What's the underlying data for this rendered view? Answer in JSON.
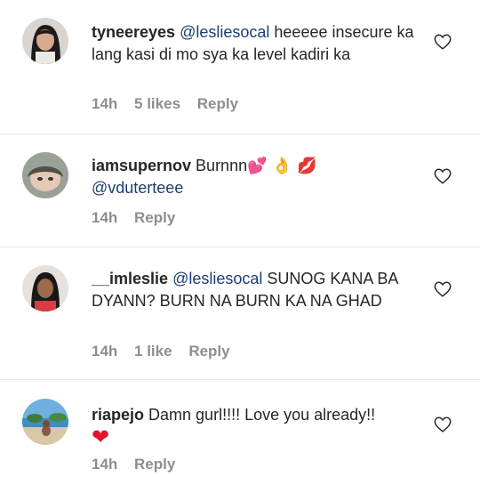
{
  "comments": [
    {
      "username": "tyneereyes",
      "mention": "@lesliesocal",
      "text": " heeeee insecure ka lang kasi di mo sya ka level kadiri ka",
      "time": "14h",
      "likes": "5 likes",
      "reply": "Reply"
    },
    {
      "username": "iamsupernov",
      "text": " Burnnn",
      "emojis": "💕 👌 💋",
      "mention": "@vduterteee",
      "time": "14h",
      "reply": "Reply"
    },
    {
      "username": "__imleslie",
      "mention": "@lesliesocal",
      "text": " SUNOG KANA BA DYANN? BURN NA BURN KA NA GHAD",
      "time": "14h",
      "likes": "1 like",
      "reply": "Reply"
    },
    {
      "username": "riapejo",
      "text": " Damn gurl!!!! Love you already!!",
      "emoji": "❤",
      "time": "14h",
      "reply": "Reply"
    }
  ],
  "colors": {
    "username": "#262626",
    "mention": "#1c3e72",
    "meta": "#8e8e8e",
    "divider": "#e6e6e6"
  },
  "icons": {
    "like": "heart-outline-icon"
  }
}
